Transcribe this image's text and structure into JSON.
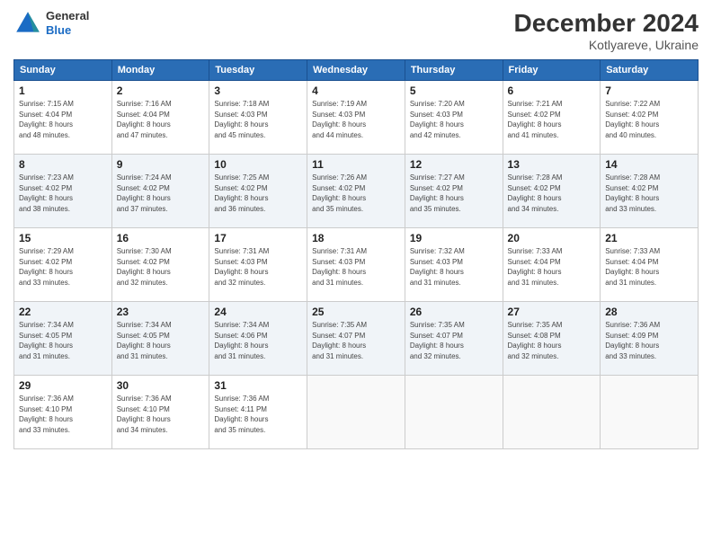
{
  "header": {
    "logo_general": "General",
    "logo_blue": "Blue",
    "month_year": "December 2024",
    "location": "Kotlyareve, Ukraine"
  },
  "weekdays": [
    "Sunday",
    "Monday",
    "Tuesday",
    "Wednesday",
    "Thursday",
    "Friday",
    "Saturday"
  ],
  "weeks": [
    [
      {
        "day": "1",
        "info": "Sunrise: 7:15 AM\nSunset: 4:04 PM\nDaylight: 8 hours\nand 48 minutes."
      },
      {
        "day": "2",
        "info": "Sunrise: 7:16 AM\nSunset: 4:04 PM\nDaylight: 8 hours\nand 47 minutes."
      },
      {
        "day": "3",
        "info": "Sunrise: 7:18 AM\nSunset: 4:03 PM\nDaylight: 8 hours\nand 45 minutes."
      },
      {
        "day": "4",
        "info": "Sunrise: 7:19 AM\nSunset: 4:03 PM\nDaylight: 8 hours\nand 44 minutes."
      },
      {
        "day": "5",
        "info": "Sunrise: 7:20 AM\nSunset: 4:03 PM\nDaylight: 8 hours\nand 42 minutes."
      },
      {
        "day": "6",
        "info": "Sunrise: 7:21 AM\nSunset: 4:02 PM\nDaylight: 8 hours\nand 41 minutes."
      },
      {
        "day": "7",
        "info": "Sunrise: 7:22 AM\nSunset: 4:02 PM\nDaylight: 8 hours\nand 40 minutes."
      }
    ],
    [
      {
        "day": "8",
        "info": "Sunrise: 7:23 AM\nSunset: 4:02 PM\nDaylight: 8 hours\nand 38 minutes."
      },
      {
        "day": "9",
        "info": "Sunrise: 7:24 AM\nSunset: 4:02 PM\nDaylight: 8 hours\nand 37 minutes."
      },
      {
        "day": "10",
        "info": "Sunrise: 7:25 AM\nSunset: 4:02 PM\nDaylight: 8 hours\nand 36 minutes."
      },
      {
        "day": "11",
        "info": "Sunrise: 7:26 AM\nSunset: 4:02 PM\nDaylight: 8 hours\nand 35 minutes."
      },
      {
        "day": "12",
        "info": "Sunrise: 7:27 AM\nSunset: 4:02 PM\nDaylight: 8 hours\nand 35 minutes."
      },
      {
        "day": "13",
        "info": "Sunrise: 7:28 AM\nSunset: 4:02 PM\nDaylight: 8 hours\nand 34 minutes."
      },
      {
        "day": "14",
        "info": "Sunrise: 7:28 AM\nSunset: 4:02 PM\nDaylight: 8 hours\nand 33 minutes."
      }
    ],
    [
      {
        "day": "15",
        "info": "Sunrise: 7:29 AM\nSunset: 4:02 PM\nDaylight: 8 hours\nand 33 minutes."
      },
      {
        "day": "16",
        "info": "Sunrise: 7:30 AM\nSunset: 4:02 PM\nDaylight: 8 hours\nand 32 minutes."
      },
      {
        "day": "17",
        "info": "Sunrise: 7:31 AM\nSunset: 4:03 PM\nDaylight: 8 hours\nand 32 minutes."
      },
      {
        "day": "18",
        "info": "Sunrise: 7:31 AM\nSunset: 4:03 PM\nDaylight: 8 hours\nand 31 minutes."
      },
      {
        "day": "19",
        "info": "Sunrise: 7:32 AM\nSunset: 4:03 PM\nDaylight: 8 hours\nand 31 minutes."
      },
      {
        "day": "20",
        "info": "Sunrise: 7:33 AM\nSunset: 4:04 PM\nDaylight: 8 hours\nand 31 minutes."
      },
      {
        "day": "21",
        "info": "Sunrise: 7:33 AM\nSunset: 4:04 PM\nDaylight: 8 hours\nand 31 minutes."
      }
    ],
    [
      {
        "day": "22",
        "info": "Sunrise: 7:34 AM\nSunset: 4:05 PM\nDaylight: 8 hours\nand 31 minutes."
      },
      {
        "day": "23",
        "info": "Sunrise: 7:34 AM\nSunset: 4:05 PM\nDaylight: 8 hours\nand 31 minutes."
      },
      {
        "day": "24",
        "info": "Sunrise: 7:34 AM\nSunset: 4:06 PM\nDaylight: 8 hours\nand 31 minutes."
      },
      {
        "day": "25",
        "info": "Sunrise: 7:35 AM\nSunset: 4:07 PM\nDaylight: 8 hours\nand 31 minutes."
      },
      {
        "day": "26",
        "info": "Sunrise: 7:35 AM\nSunset: 4:07 PM\nDaylight: 8 hours\nand 32 minutes."
      },
      {
        "day": "27",
        "info": "Sunrise: 7:35 AM\nSunset: 4:08 PM\nDaylight: 8 hours\nand 32 minutes."
      },
      {
        "day": "28",
        "info": "Sunrise: 7:36 AM\nSunset: 4:09 PM\nDaylight: 8 hours\nand 33 minutes."
      }
    ],
    [
      {
        "day": "29",
        "info": "Sunrise: 7:36 AM\nSunset: 4:10 PM\nDaylight: 8 hours\nand 33 minutes."
      },
      {
        "day": "30",
        "info": "Sunrise: 7:36 AM\nSunset: 4:10 PM\nDaylight: 8 hours\nand 34 minutes."
      },
      {
        "day": "31",
        "info": "Sunrise: 7:36 AM\nSunset: 4:11 PM\nDaylight: 8 hours\nand 35 minutes."
      },
      {
        "day": "",
        "info": ""
      },
      {
        "day": "",
        "info": ""
      },
      {
        "day": "",
        "info": ""
      },
      {
        "day": "",
        "info": ""
      }
    ]
  ]
}
